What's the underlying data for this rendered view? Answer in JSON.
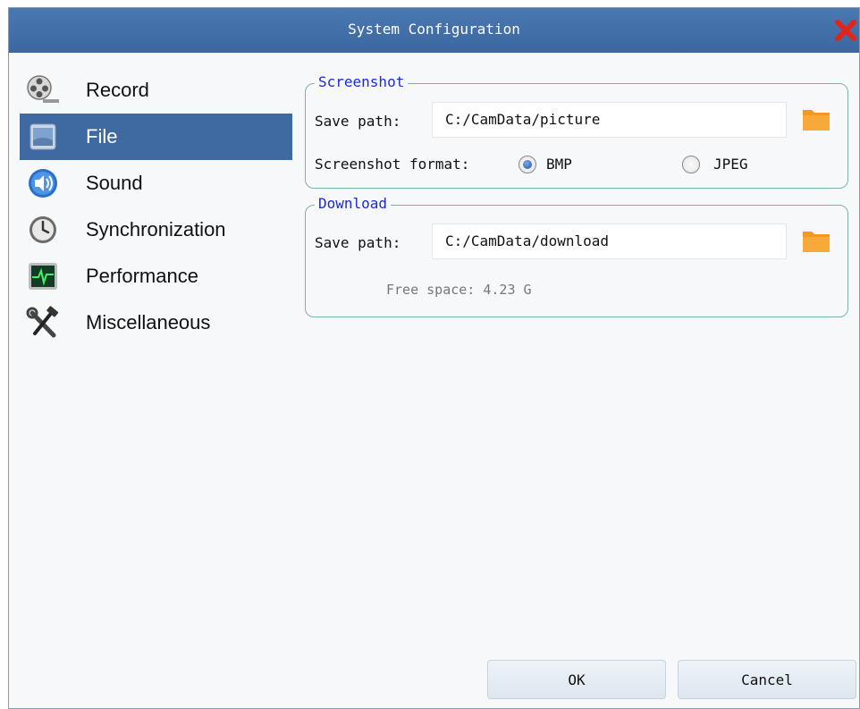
{
  "window": {
    "title": "System Configuration"
  },
  "sidebar": {
    "items": [
      {
        "label": "Record",
        "icon": "film-reel-icon"
      },
      {
        "label": "File",
        "icon": "file-drive-icon",
        "selected": true
      },
      {
        "label": "Sound",
        "icon": "speaker-icon"
      },
      {
        "label": "Synchronization",
        "icon": "clock-icon"
      },
      {
        "label": "Performance",
        "icon": "activity-monitor-icon"
      },
      {
        "label": "Miscellaneous",
        "icon": "tools-icon"
      }
    ]
  },
  "screenshot": {
    "legend": "Screenshot",
    "save_path_label": "Save path:",
    "save_path_value": "C:/CamData/picture",
    "format_label": "Screenshot format:",
    "options": [
      {
        "label": "BMP",
        "checked": true
      },
      {
        "label": "JPEG",
        "checked": false
      }
    ]
  },
  "download": {
    "legend": "Download",
    "save_path_label": "Save path:",
    "save_path_value": "C:/CamData/download",
    "free_space": "Free space: 4.23 G"
  },
  "buttons": {
    "ok": "OK",
    "cancel": "Cancel"
  },
  "colors": {
    "titlebar": "#3f6aa1",
    "selection": "#3f6aa1",
    "legend": "#1b2ad6",
    "folder": "#f39a1e",
    "close": "#e0261c"
  }
}
